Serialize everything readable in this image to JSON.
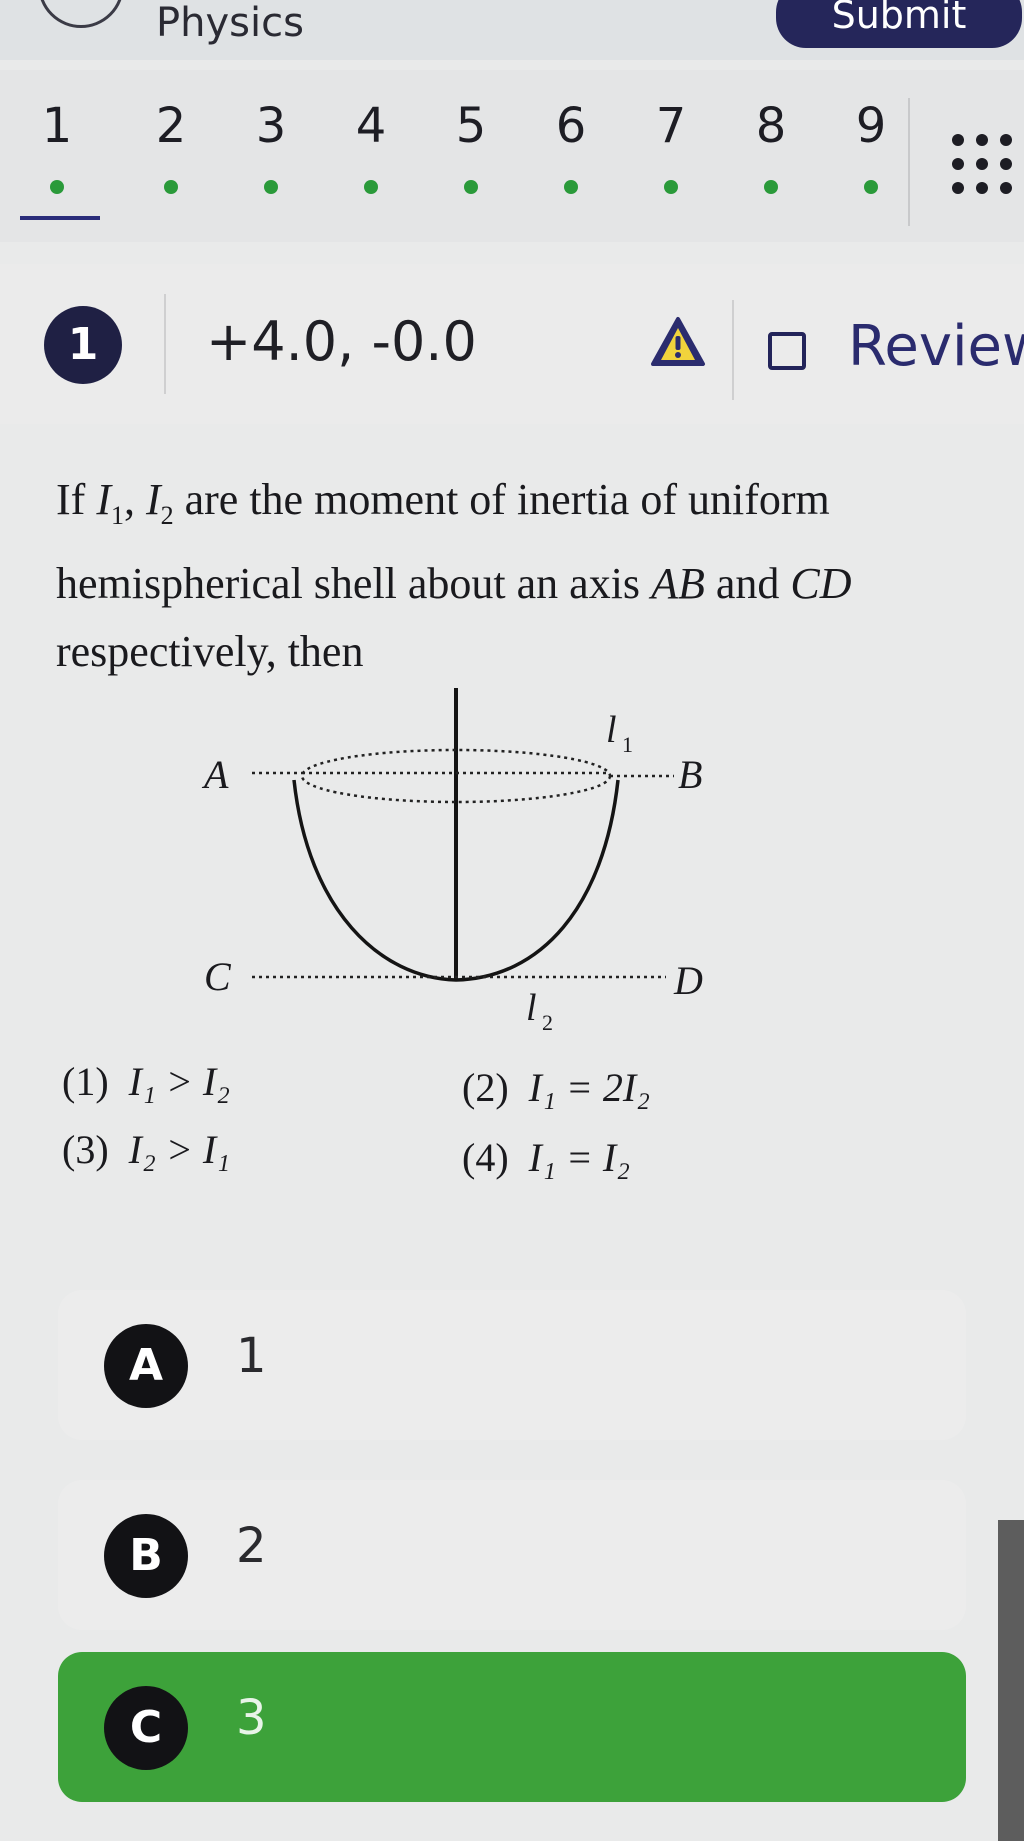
{
  "header": {
    "subject": "Physics",
    "submit_label": "Submit"
  },
  "question_nav": {
    "numbers": [
      "1",
      "2",
      "3",
      "4",
      "5",
      "6",
      "7",
      "8",
      "9"
    ],
    "active": "1",
    "dot_color": "#2a9a3a"
  },
  "info": {
    "question_number": "1",
    "marks": "+4.0, -0.0",
    "review_label": "Review"
  },
  "question": {
    "text_parts": {
      "p1": "If ",
      "i1": "I",
      "s1": "1",
      "p2": ", ",
      "i2": "I",
      "s2": "2",
      "p3": " are the moment of inertia of uniform hemispherical shell about an axis ",
      "ab": "AB",
      "p4": " and ",
      "cd": "CD",
      "p5": " respectively, then"
    },
    "figure_labels": {
      "a": "A",
      "b": "B",
      "c": "C",
      "d": "D",
      "l1": "l",
      "l1_sub": "1",
      "l2": "l",
      "l2_sub": "2"
    },
    "options": [
      {
        "num": "(1)",
        "expr": "I₁ > I₂"
      },
      {
        "num": "(2)",
        "expr": "I₁ = 2I₂"
      },
      {
        "num": "(3)",
        "expr": "I₂ > I₁"
      },
      {
        "num": "(4)",
        "expr": "I₁ = I₂"
      }
    ]
  },
  "choices": [
    {
      "letter": "A",
      "value": "1",
      "selected": false
    },
    {
      "letter": "B",
      "value": "2",
      "selected": false
    },
    {
      "letter": "C",
      "value": "3",
      "selected": true
    }
  ],
  "colors": {
    "accent_dark": "#1f2044",
    "selected_green": "#3da23a"
  }
}
